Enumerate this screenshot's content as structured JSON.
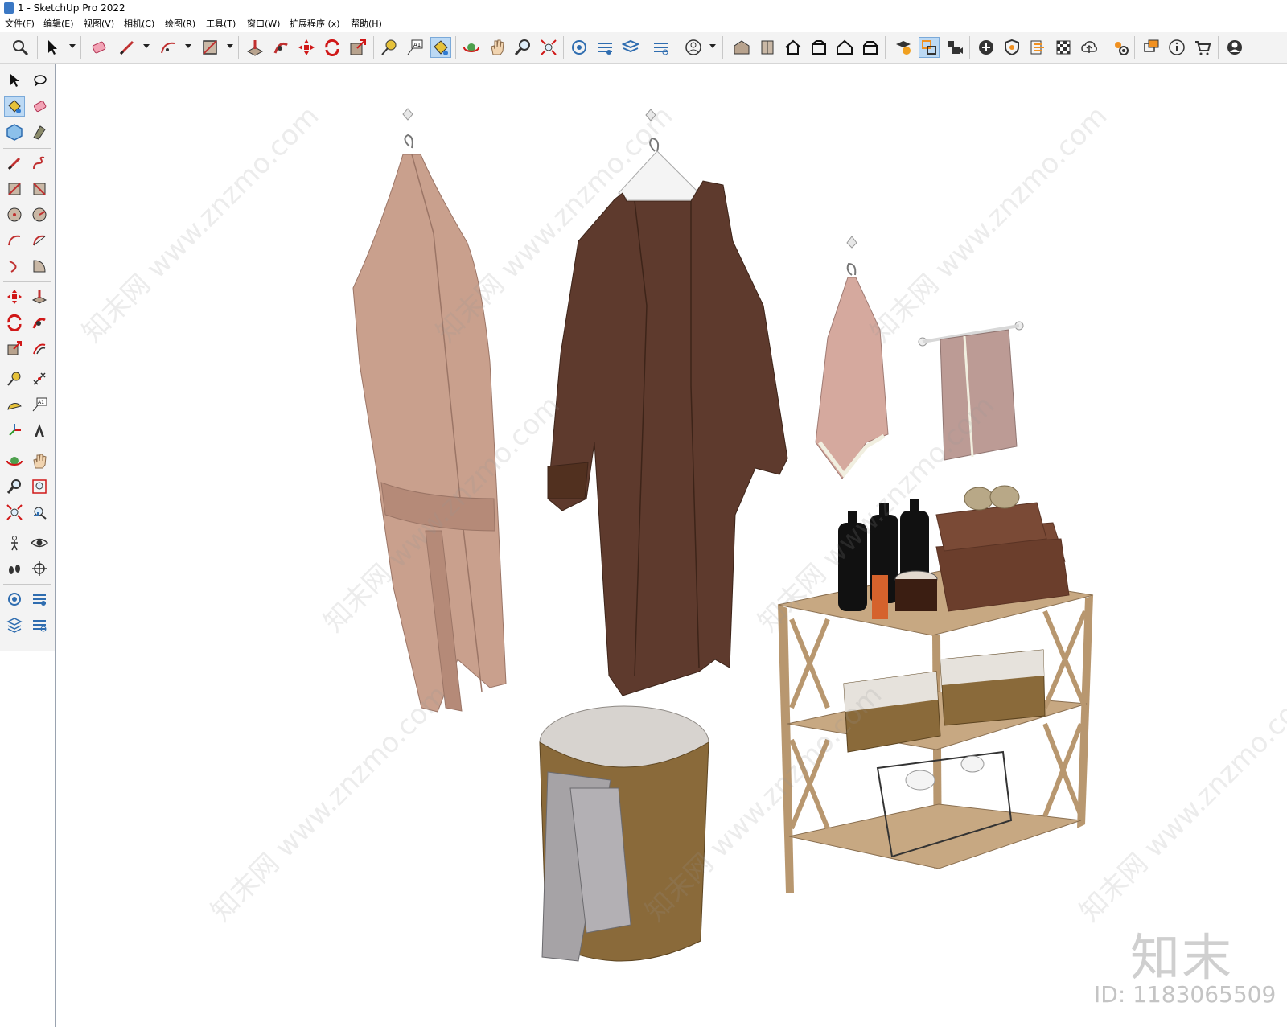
{
  "window": {
    "title": "1 - SketchUp Pro 2022"
  },
  "menu": [
    "文件(F)",
    "编辑(E)",
    "视图(V)",
    "相机(C)",
    "绘图(R)",
    "工具(T)",
    "窗口(W)",
    "扩展程序 (x)",
    "帮助(H)"
  ],
  "toolbar_icons": [
    "search-icon",
    "select-icon",
    "eraser-icon",
    "pencil-icon",
    "arc-icon",
    "rectangle-icon",
    "push-pull-icon",
    "follow-me-icon",
    "move-icon",
    "rotate-icon",
    "scale-icon",
    "tape-measure-icon",
    "text-icon",
    "paint-bucket-icon",
    "orbit-icon",
    "pan-icon",
    "zoom-icon",
    "zoom-extents-icon",
    "outliner-icon",
    "layers-icon",
    "tags-icon",
    "components-icon",
    "account-icon",
    "warehouse-icon",
    "section-icon",
    "home-icon",
    "front-view-icon",
    "house-icon",
    "back-view-icon",
    "solid-tools-icon",
    "scenes-icon",
    "camera-icon",
    "add-location-icon",
    "shield-icon",
    "styles-icon",
    "texture-icon",
    "cloud-icon",
    "settings-icon",
    "chat-icon",
    "info-icon",
    "cart-icon",
    "user-icon"
  ],
  "watermark": {
    "text": "知末网 www.znzmo.com"
  },
  "logo": {
    "text": "知末",
    "id": "ID: 1183065509"
  },
  "colors": {
    "toolbar_bg": "#f3f3f3",
    "active_bg": "#bcd9f4"
  }
}
